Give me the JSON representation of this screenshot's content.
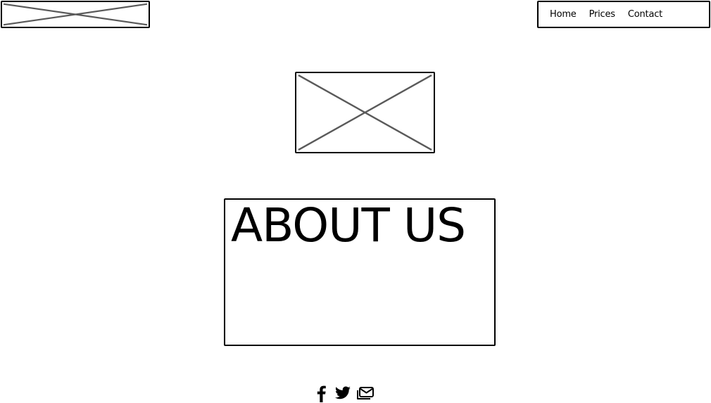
{
  "header": {
    "logo": {
      "icon": "image-placeholder-icon"
    },
    "nav": {
      "items": [
        {
          "label": "Home"
        },
        {
          "label": "Prices"
        },
        {
          "label": "Contact"
        }
      ]
    }
  },
  "main": {
    "hero_image": {
      "icon": "image-placeholder-icon"
    },
    "about": {
      "title": "ABOUT US"
    }
  },
  "footer": {
    "social": [
      {
        "icon": "facebook-icon"
      },
      {
        "icon": "twitter-icon"
      },
      {
        "icon": "email-icon"
      }
    ]
  },
  "colors": {
    "stroke": "#000000",
    "placeholder_cross": "#5a5a5a",
    "background": "#ffffff"
  }
}
